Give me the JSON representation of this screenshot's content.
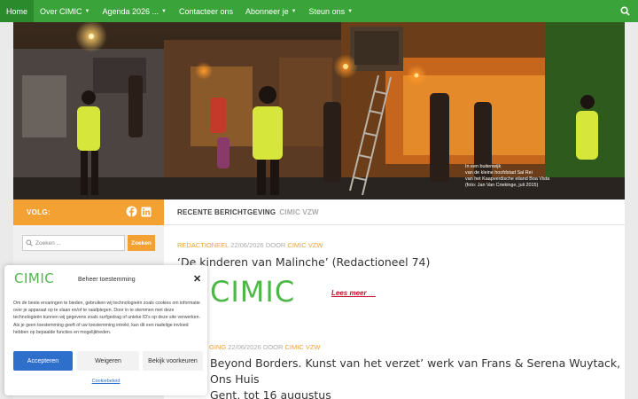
{
  "nav": {
    "items": [
      {
        "label": "Home",
        "active": true,
        "dropdown": false
      },
      {
        "label": "Over CIMIC",
        "active": false,
        "dropdown": true
      },
      {
        "label": "Agenda 2026 ...",
        "active": false,
        "dropdown": true
      },
      {
        "label": "Contacteer ons",
        "active": false,
        "dropdown": false
      },
      {
        "label": "Abonneer je",
        "active": false,
        "dropdown": true
      },
      {
        "label": "Steun ons",
        "active": false,
        "dropdown": true
      }
    ],
    "search_icon": "search-icon",
    "bg_color": "#3aa43a"
  },
  "hero": {
    "caption_lines": [
      "In een buitenwijk",
      "van de kleine hoofdstad Sal Rei",
      "van het Kaapverdische eiland Boa Vista",
      "(foto: Jan Van Criekinge, juli 2015)"
    ]
  },
  "sidebar": {
    "follow_label": "VOLG:",
    "social_icons": [
      "facebook-icon",
      "linkedin-icon"
    ],
    "search_placeholder": "Zoeken ...",
    "search_button": "Zoeken",
    "accent_color": "#f2a132"
  },
  "main": {
    "section_title": "RECENTE BERICHTGEVING",
    "section_sub": "CIMIC VZW",
    "posts": [
      {
        "category": "REDACTIONEEL",
        "date": "22/06/2026",
        "by_label": "DOOR",
        "author": "CIMIC VZW",
        "title": "‘De kinderen van Malinche’ (Redactioneel 74)",
        "logo_text": "CIMIC",
        "read_more": "Lees meer",
        "read_more_suffix": "…"
      },
      {
        "category": "GING",
        "date": "22/06/2026",
        "by_label": "DOOR",
        "author": "CIMIC VZW",
        "title_line1": "Beyond Borders. Kunst van het verzet’ werk van Frans & Serena Wuytack, Ons Huis",
        "title_line2": "Gent, tot 16 augustus"
      }
    ]
  },
  "consent": {
    "logo_text": "CIMIC",
    "title": "Beheer toestemming",
    "close_icon": "close-icon",
    "text": "Om de beste ervaringen te bieden, gebruiken wij technologieën zoals cookies om informatie over je apparaat op te slaan en/of te raadplegen. Door in te stemmen met deze technologieën kunnen wij gegevens zoals surfgedrag of unieke ID's op deze site verwerken. Als je geen toestemming geeft of uw toestemming intrekt, kan dit een nadelige invloed hebben op bepaalde functies en mogelijkheden.",
    "accept": "Accepteren",
    "deny": "Weigeren",
    "preferences": "Bekijk voorkeuren",
    "policy": "Cookiebeleid",
    "accent_color": "#2e6fcc"
  }
}
